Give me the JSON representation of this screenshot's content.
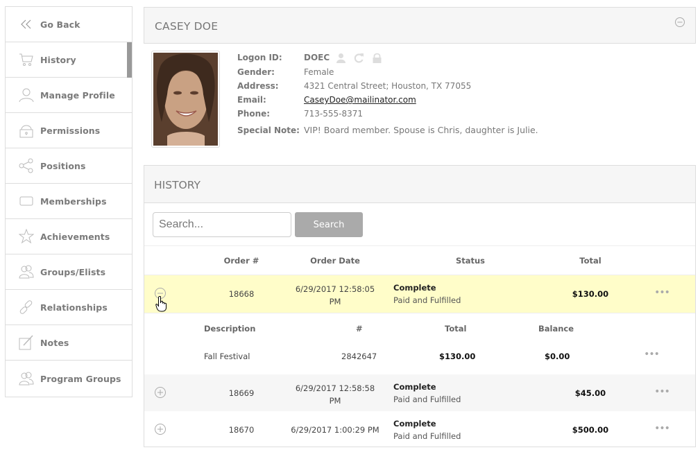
{
  "sidebar": {
    "items": [
      {
        "label": "Go Back",
        "icon": "double-chevron-left-icon",
        "active": false
      },
      {
        "label": "History",
        "icon": "cart-icon",
        "active": true
      },
      {
        "label": "Manage Profile",
        "icon": "user-icon",
        "active": false
      },
      {
        "label": "Permissions",
        "icon": "lock-icon",
        "active": false
      },
      {
        "label": "Positions",
        "icon": "share-icon",
        "active": false
      },
      {
        "label": "Memberships",
        "icon": "card-icon",
        "active": false
      },
      {
        "label": "Achievements",
        "icon": "star-icon",
        "active": false
      },
      {
        "label": "Groups/Elists",
        "icon": "users-icon",
        "active": false
      },
      {
        "label": "Relationships",
        "icon": "link-icon",
        "active": false
      },
      {
        "label": "Notes",
        "icon": "note-icon",
        "active": false
      },
      {
        "label": "Program Groups",
        "icon": "users-icon",
        "active": false
      }
    ]
  },
  "profile": {
    "name": "CASEY DOE",
    "labels": {
      "logon": "Logon ID:",
      "gender": "Gender:",
      "address": "Address:",
      "email": "Email:",
      "phone": "Phone:",
      "note": "Special Note:"
    },
    "logon_id": "DOEC",
    "gender": "Female",
    "address": "4321 Central Street; Houston, TX 77055",
    "email": "CaseyDoe@mailinator.com",
    "phone": "713-555-8371",
    "special_note": "VIP! Board member. Spouse is Chris, daughter is Julie."
  },
  "history": {
    "title": "HISTORY",
    "search": {
      "placeholder": "Search...",
      "button": "Search"
    },
    "columns": [
      "Order #",
      "Order Date",
      "Status",
      "Total"
    ],
    "orders": [
      {
        "order": "18668",
        "date_line1": "6/29/2017 12:58:05",
        "date_line2": "PM",
        "status": "Complete",
        "status_sub": "Paid and Fulfilled",
        "total": "$130.00",
        "expanded": true,
        "details": {
          "columns": [
            "Description",
            "#",
            "Total",
            "Balance"
          ],
          "items": [
            {
              "description": "Fall Festival",
              "number": "2842647",
              "total": "$130.00",
              "balance": "$0.00"
            }
          ]
        }
      },
      {
        "order": "18669",
        "date_line1": "6/29/2017 12:58:58",
        "date_line2": "PM",
        "status": "Complete",
        "status_sub": "Paid and Fulfilled",
        "total": "$45.00",
        "expanded": false
      },
      {
        "order": "18670",
        "date_line1": "6/29/2017 1:00:29 PM",
        "date_line2": "",
        "status": "Complete",
        "status_sub": "Paid and Fulfilled",
        "total": "$500.00",
        "expanded": false
      }
    ],
    "more_label": "•••"
  },
  "colors": {
    "expanded_row": "#fffdc9",
    "alt_row": "#f6f6f6",
    "active_indicator": "#999999",
    "search_button": "#aaaaaa"
  }
}
